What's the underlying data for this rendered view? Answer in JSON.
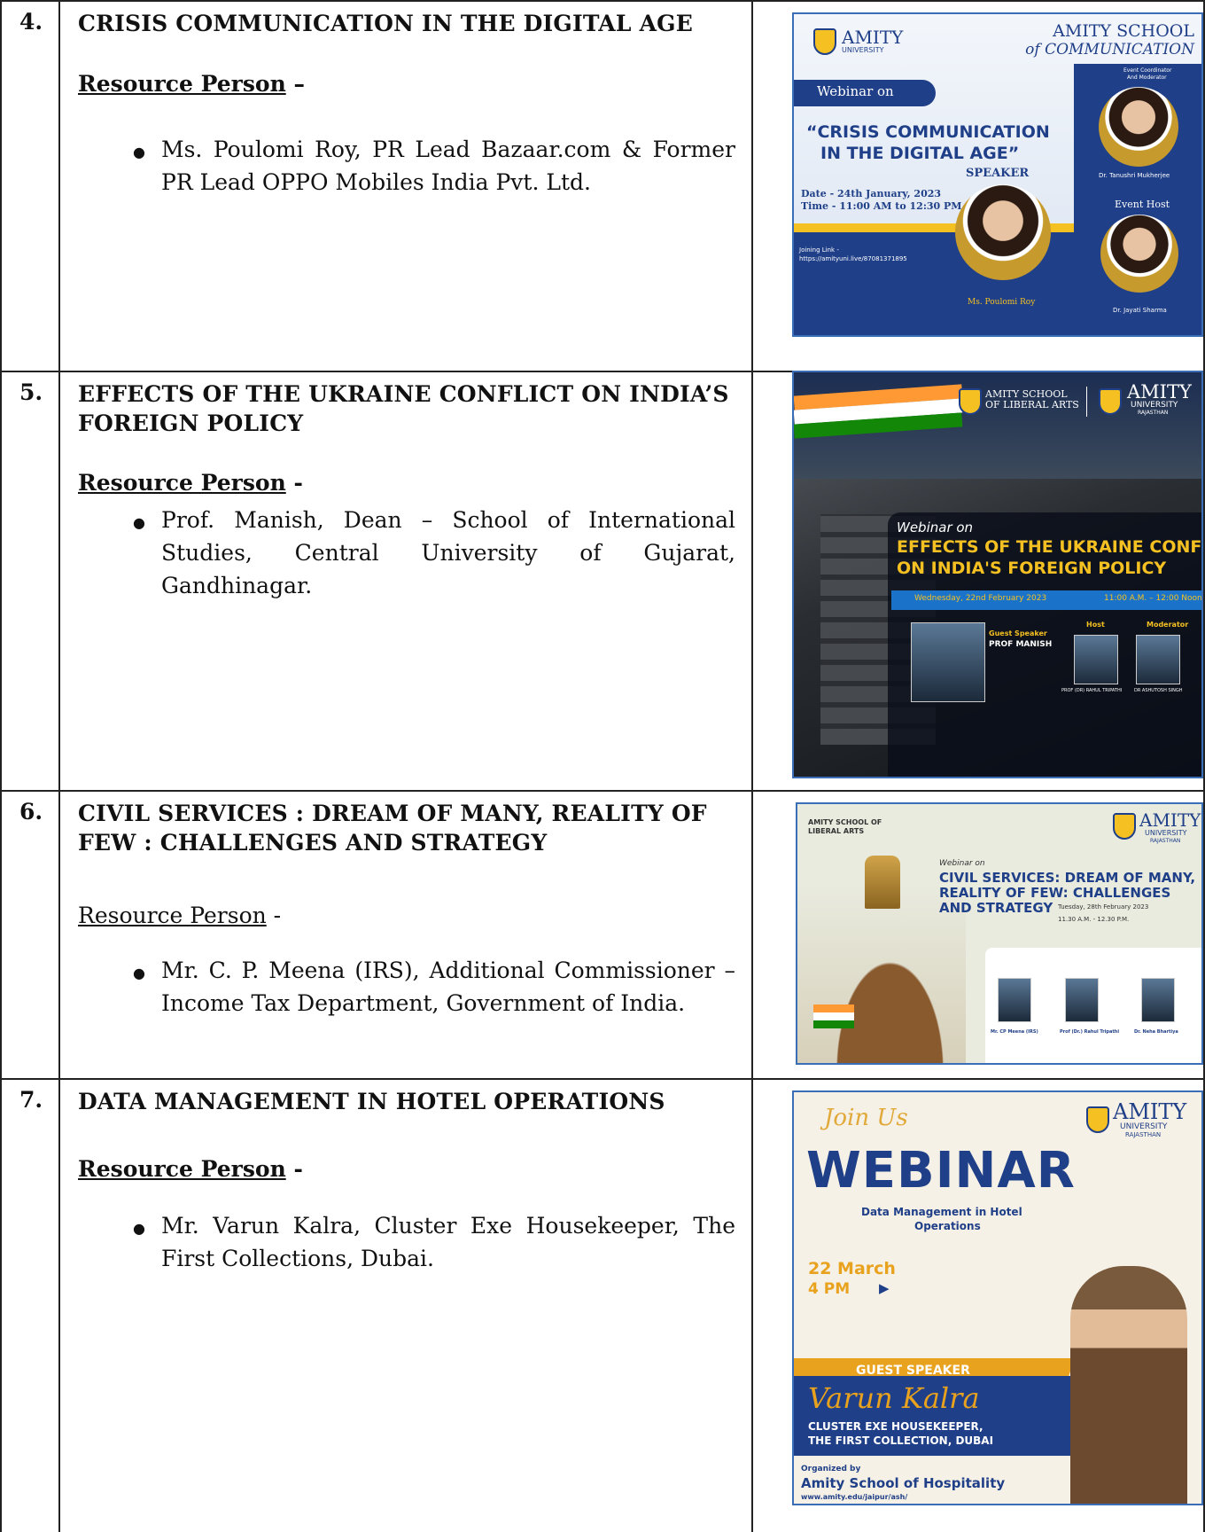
{
  "rows": [
    {
      "number": "4.",
      "title": "CRISIS COMMUNICATION IN THE DIGITAL AGE",
      "resource_label": "Resource Person",
      "resource_suffix": " –",
      "person": "Ms. Poulomi Roy, PR Lead Bazaar.com & Former PR Lead OPPO Mobiles India Pvt. Ltd.",
      "poster": {
        "brand": "AMITY",
        "brand_sub": "UNIVERSITY",
        "school_1": "AMITY SCHOOL",
        "school_2": "of COMMUNICATION",
        "webinar_tag": "Webinar on",
        "headline_1": "“CRISIS COMMUNICATION",
        "headline_2": "IN THE DIGITAL AGE”",
        "speaker_label": "SPEAKER",
        "date": "Date - 24th January, 2023",
        "time": "Time - 11:00 AM to 12:30 PM",
        "joining_label": "Joining Link -",
        "joining_url": "https://amityuni.live/87081371895",
        "speaker_name": "Ms. Poulomi Roy",
        "coordinator_label_1": "Event Coordinator",
        "coordinator_label_2": "And Moderator",
        "coordinator_name": "Dr. Tanushri Mukherjee",
        "host_label": "Event Host",
        "host_name": "Dr. Jayati Sharma"
      }
    },
    {
      "number": "5.",
      "title": "EFFECTS OF THE UKRAINE CONFLICT ON INDIA’S FOREIGN POLICY",
      "resource_label": "Resource Person",
      "resource_suffix": " -",
      "person": "Prof. Manish, Dean – School of International Studies, Central University of Gujarat, Gandhinagar.",
      "poster": {
        "school_1": "AMITY SCHOOL",
        "school_2": "OF LIBERAL ARTS",
        "brand": "AMITY",
        "brand_sub": "UNIVERSITY",
        "brand_sub2": "RAJASTHAN",
        "webinar_tag": "Webinar on",
        "headline_1": "EFFECTS OF THE UKRAINE CONFLICT",
        "headline_2": "ON INDIA'S FOREIGN POLICY",
        "date": "Wednesday, 22nd February 2023",
        "time": "11:00 A.M. – 12:00 Noon",
        "guest_label": "Guest Speaker",
        "guest_name": "PROF MANISH",
        "host_label": "Host",
        "host_name": "PROF (DR) RAHUL TRIPATHI",
        "moderator_label": "Moderator",
        "moderator_name": "DR ASHUTOSH SINGH"
      }
    },
    {
      "number": "6.",
      "title": "CIVIL SERVICES : DREAM OF MANY, REALITY OF FEW : CHALLENGES AND STRATEGY",
      "resource_label": "Resource Person",
      "resource_suffix": " -",
      "person": "Mr. C. P. Meena (IRS), Additional Commissioner – Income Tax Department, Government of India.",
      "poster": {
        "school_1": "AMITY SCHOOL OF",
        "school_2": "LIBERAL ARTS",
        "brand": "AMITY",
        "brand_sub": "UNIVERSITY",
        "brand_sub2": "RAJASTHAN",
        "webinar_tag": "Webinar on",
        "headline_1": "CIVIL SERVICES: DREAM OF MANY,",
        "headline_2": "REALITY OF FEW: CHALLENGES",
        "headline_3": "AND STRATEGY",
        "date": "Tuesday, 28th February 2023",
        "time": "11.30 A.M. - 12.30 P.M.",
        "p1": "Mr. CP Meena (IRS)",
        "p2": "Prof (Dr.) Rahul Tripathi",
        "p3": "Dr. Neha Bhartiya"
      }
    },
    {
      "number": "7.",
      "title": "DATA MANAGEMENT IN HOTEL OPERATIONS",
      "resource_label": "Resource Person",
      "resource_suffix": " -",
      "person": "Mr. Varun Kalra, Cluster Exe Housekeeper, The First Collections, Dubai.",
      "poster": {
        "join": "Join Us",
        "brand": "AMITY",
        "brand_sub": "UNIVERSITY",
        "brand_sub2": "RAJASTHAN",
        "headline": "WEBINAR",
        "sub_1": "Data Management in Hotel",
        "sub_2": "Operations",
        "date": "22 March",
        "time": "4 PM",
        "guest_label": "GUEST SPEAKER",
        "guest_name": "Varun Kalra",
        "role_1": "CLUSTER EXE HOUSEKEEPER,",
        "role_2": "THE FIRST COLLECTION, DUBAI",
        "organized_label": "Organized by",
        "organizer": "Amity School of Hospitality",
        "url": "www.amity.edu/jaipur/ash/"
      }
    }
  ]
}
